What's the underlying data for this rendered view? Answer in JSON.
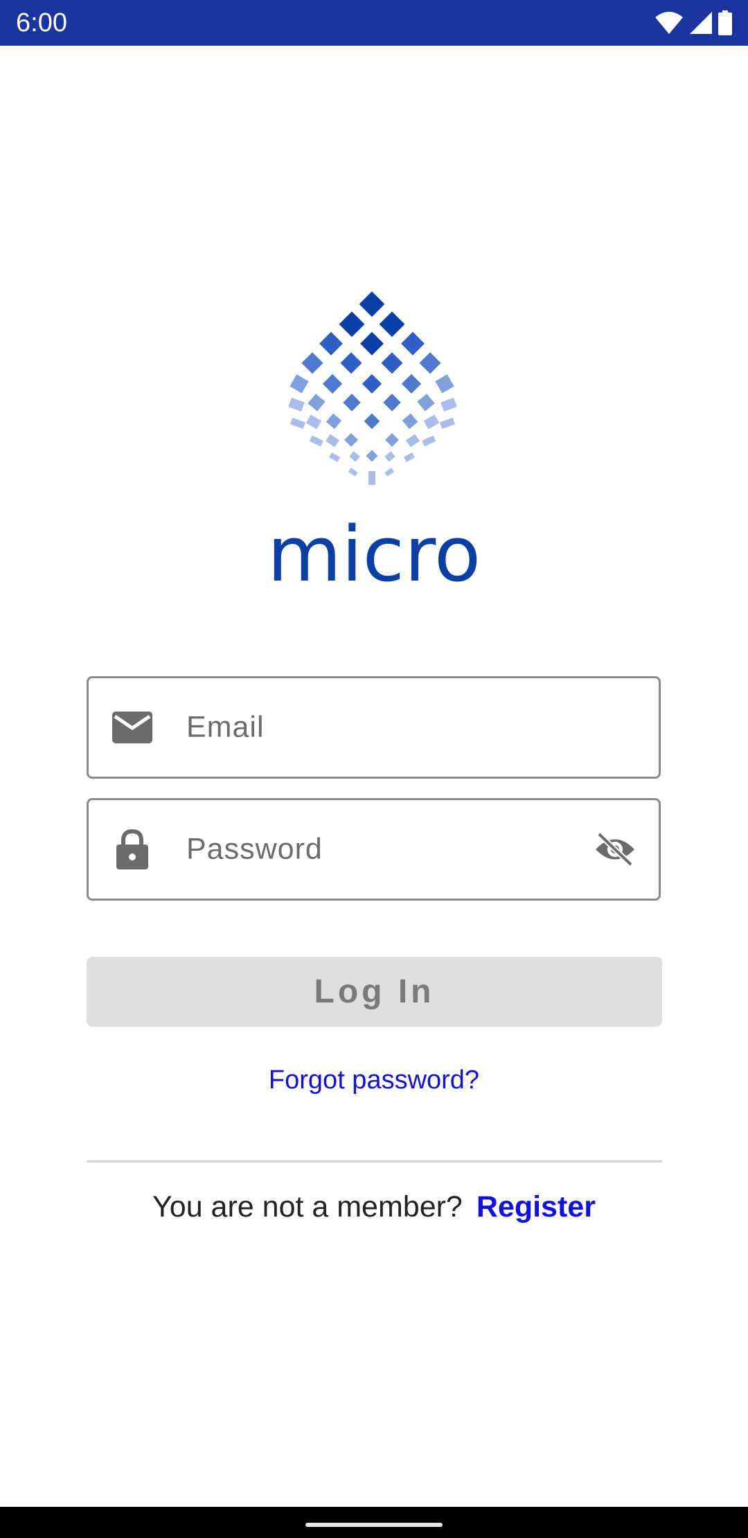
{
  "status_bar": {
    "time": "6:00",
    "background": "#1a34a0",
    "icons": [
      "wifi-icon",
      "signal-icon",
      "battery-icon"
    ]
  },
  "logo": {
    "wordmark": "micro",
    "colors": [
      "#0a3fa8",
      "#2f5fc4",
      "#7fa0dd",
      "#a9bde8"
    ]
  },
  "login_form": {
    "email": {
      "placeholder": "Email",
      "value": "",
      "icon": "email-icon"
    },
    "password": {
      "placeholder": "Password",
      "value": "",
      "icon": "lock-icon",
      "toggle_icon": "visibility-off-icon"
    },
    "login_label": "Log In",
    "forgot_label": "Forgot password?"
  },
  "register": {
    "prompt": "You are not a member?",
    "link_label": "Register"
  },
  "colors": {
    "accent": "#1010e0",
    "button_disabled_bg": "#dfdfdf",
    "button_disabled_text": "#7a7a7a"
  }
}
